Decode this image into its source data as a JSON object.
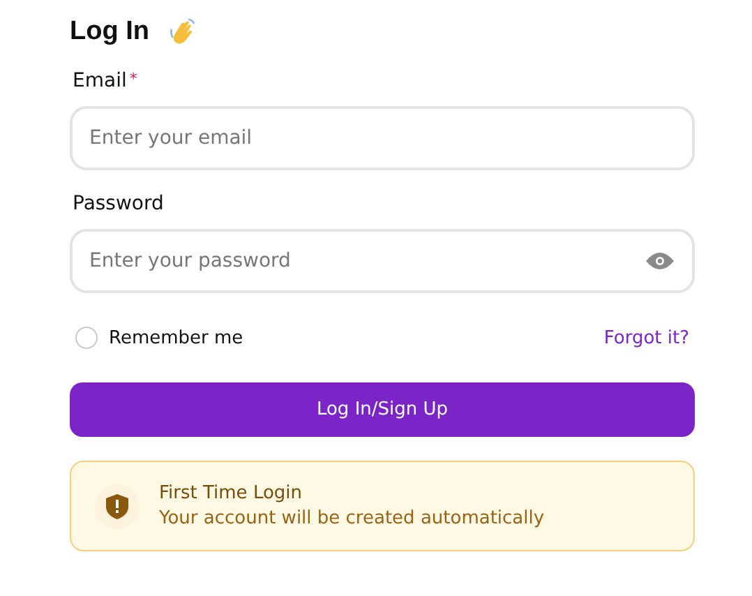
{
  "title": "Log In",
  "fields": [
    {
      "label": "Email",
      "required_mark": "*",
      "placeholder": "Enter your email",
      "kind": "text"
    },
    {
      "label": "Password",
      "placeholder": "Enter your password",
      "kind": "password"
    }
  ],
  "remember": {
    "label": "Remember me",
    "checked": false
  },
  "forgot_link": "Forgot it?",
  "submit_button": "Log In/Sign Up",
  "notice": {
    "title": "First Time Login",
    "message": "Your account will be created automatically"
  }
}
